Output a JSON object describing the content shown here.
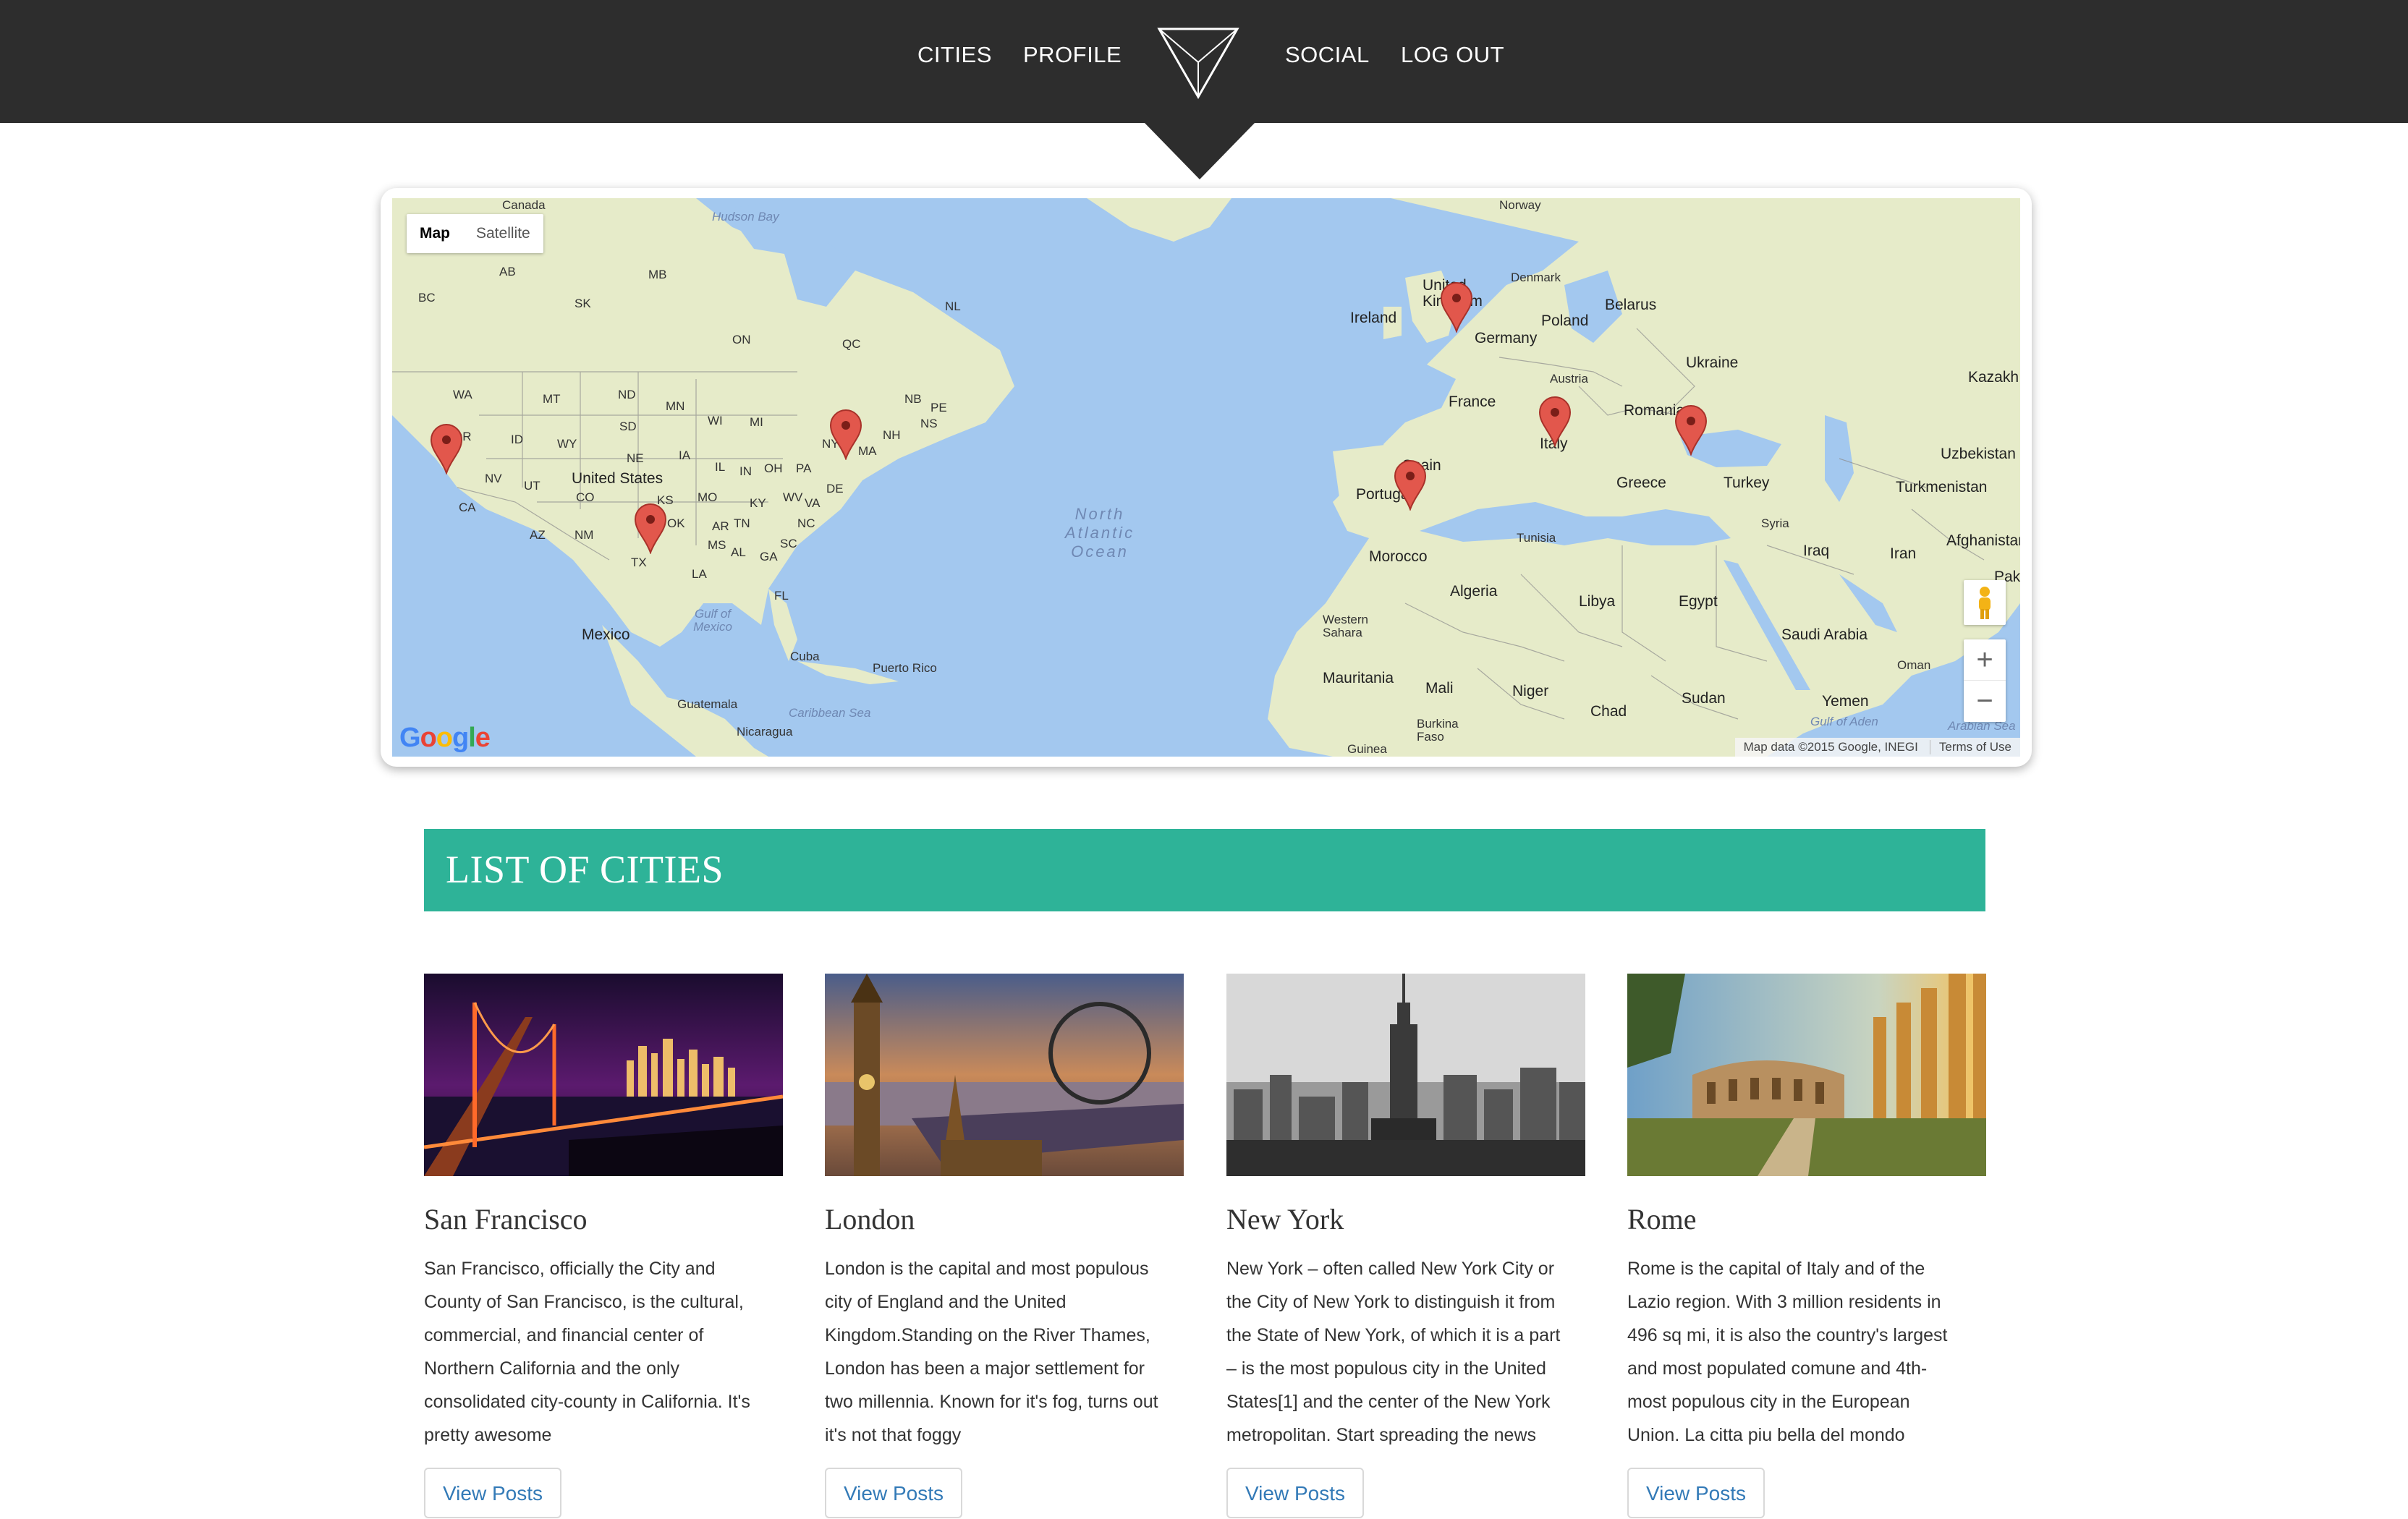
{
  "nav": {
    "links": [
      "CITIES",
      "PROFILE",
      "SOCIAL",
      "LOG OUT"
    ],
    "logo_icon": "inverted-triangle-logo"
  },
  "map": {
    "type_control": {
      "map": "Map",
      "satellite": "Satellite"
    },
    "google_logo": "Google",
    "attribution": "Map data ©2015 Google, INEGI",
    "terms": "Terms of Use",
    "zoom_in": "+",
    "zoom_out": "−",
    "labels": {
      "canada": "Canada",
      "hudson_bay": "Hudson Bay",
      "ab": "AB",
      "mb": "MB",
      "sk": "SK",
      "bc": "BC",
      "nl": "NL",
      "on": "ON",
      "qc": "QC",
      "wa": "WA",
      "mt": "MT",
      "nd": "ND",
      "mn": "MN",
      "or": "OR",
      "id": "ID",
      "wy": "WY",
      "sd": "SD",
      "wi": "WI",
      "mi": "MI",
      "nv": "NV",
      "ut": "UT",
      "ne": "NE",
      "ia": "IA",
      "il": "IL",
      "in": "IN",
      "oh": "OH",
      "pa": "PA",
      "ny": "NY",
      "nb": "NB",
      "pe": "PE",
      "ns": "NS",
      "nh": "NH",
      "ma": "MA",
      "ca": "CA",
      "co": "CO",
      "ks": "KS",
      "mo": "MO",
      "ky": "KY",
      "wv": "WV",
      "va": "VA",
      "de": "DE",
      "us": "United States",
      "az": "AZ",
      "nm": "NM",
      "ok": "OK",
      "ar": "AR",
      "tn": "TN",
      "nc": "NC",
      "sc": "SC",
      "ms": "MS",
      "al": "AL",
      "ga": "GA",
      "tx": "TX",
      "la": "LA",
      "fl": "FL",
      "mexico": "Mexico",
      "gulf": "Gulf of Mexico",
      "cuba": "Cuba",
      "puerto_rico": "Puerto Rico",
      "guatemala": "Guatemala",
      "caribbean": "Caribbean Sea",
      "nicaragua": "Nicaragua",
      "ocean": "North Atlantic Ocean",
      "norway": "Norway",
      "uk": "United Kingdom",
      "denmark": "Denmark",
      "ireland": "Ireland",
      "belarus": "Belarus",
      "poland": "Poland",
      "germany": "Germany",
      "ukraine": "Ukraine",
      "kazakh": "Kazakh",
      "austria": "Austria",
      "france": "France",
      "romania": "Romania",
      "italy": "Italy",
      "uzbekistan": "Uzbekistan",
      "spain": "Spain",
      "portugal": "Portugal",
      "greece": "Greece",
      "turkey": "Turkey",
      "turkmenistan": "Turkmenistan",
      "syria": "Syria",
      "afghanistan": "Afghanistan",
      "tunisia": "Tunisia",
      "iraq": "Iraq",
      "iran": "Iran",
      "morocco": "Morocco",
      "pak": "Pak",
      "algeria": "Algeria",
      "libya": "Libya",
      "egypt": "Egypt",
      "western_sahara": "Western Sahara",
      "saudi": "Saudi Arabia",
      "oman": "Oman",
      "mauritania": "Mauritania",
      "mali": "Mali",
      "niger": "Niger",
      "chad": "Chad",
      "sudan": "Sudan",
      "yemen": "Yemen",
      "burkina": "Burkina Faso",
      "guinea": "Guinea",
      "gulf_aden": "Gulf of Aden",
      "arabian": "Arabian Sea"
    },
    "markers": [
      "San Francisco",
      "Texas",
      "New York",
      "London",
      "Rome",
      "Istanbul",
      "Spain"
    ],
    "colors": {
      "land": "#e8ecd0",
      "water": "#a3c8ef",
      "marker": "#e2574c"
    }
  },
  "list": {
    "title": "LIST OF CITIES",
    "cities": [
      {
        "name": "San Francisco",
        "lines": [
          "San Francisco, officially the City and",
          "County of San Francisco, is the cultural,",
          "commercial, and financial center of",
          "Northern California and the only",
          "consolidated city-county in California. It's",
          "pretty awesome"
        ],
        "button": "View Posts"
      },
      {
        "name": "London",
        "lines": [
          "London is the capital and most populous",
          "city of England and the United",
          "Kingdom.Standing on the River Thames,",
          "London has been a major settlement for",
          "two millennia. Known for it's fog, turns out",
          "it's not that foggy"
        ],
        "button": "View Posts"
      },
      {
        "name": "New York",
        "lines": [
          "New York – often called New York City or",
          "the City of New York to distinguish it from",
          "the State of New York, of which it is a part",
          "– is the most populous city in the United",
          "States[1] and the center of the New York",
          "metropolitan. Start spreading the news"
        ],
        "button": "View Posts"
      },
      {
        "name": "Rome",
        "lines": [
          "Rome is the capital of Italy and of the",
          "Lazio region. With 3 million residents in",
          "496 sq mi, it is also the country's largest",
          "and most populated comune and 4th-",
          "most populous city in the European",
          "Union. La citta piu bella del mondo"
        ],
        "button": "View Posts"
      }
    ]
  },
  "colors": {
    "nav_bg": "#2d2d2d",
    "header_bg": "#2eb398",
    "link": "#337ab7"
  }
}
